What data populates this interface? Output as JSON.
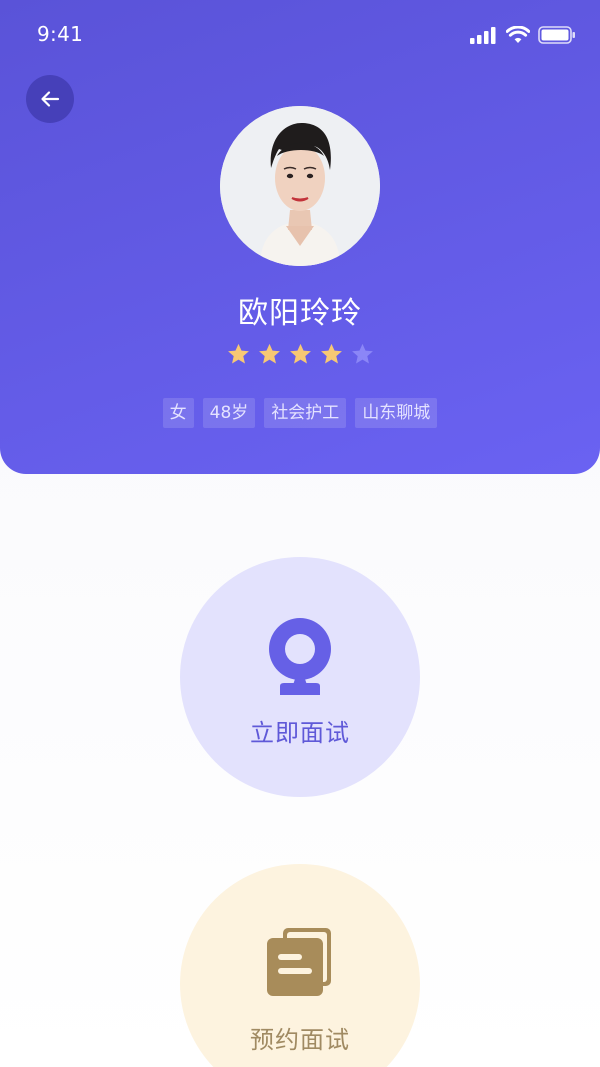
{
  "status_bar": {
    "time": "9:41",
    "icons": [
      "signal-icon",
      "wifi-icon",
      "battery-icon"
    ]
  },
  "header": {
    "back_icon": "arrow-left-icon",
    "name": "欧阳玲玲",
    "rating": {
      "value": 4,
      "max": 5
    },
    "tags": [
      "女",
      "48岁",
      "社会护工",
      "山东聊城"
    ]
  },
  "actions": {
    "interview_now": {
      "label": "立即面试",
      "icon": "webcam-icon"
    },
    "interview_book": {
      "label": "预约面试",
      "icon": "documents-icon"
    }
  },
  "colors": {
    "header_primary": "#6a62f2",
    "star_filled": "#f7c874",
    "star_empty": "#8b86f7",
    "interview_now_bg": "#e3e2fd",
    "interview_now_accent": "#5f59d8",
    "interview_book_bg": "#fdf3df",
    "interview_book_accent": "#a88c5a"
  }
}
